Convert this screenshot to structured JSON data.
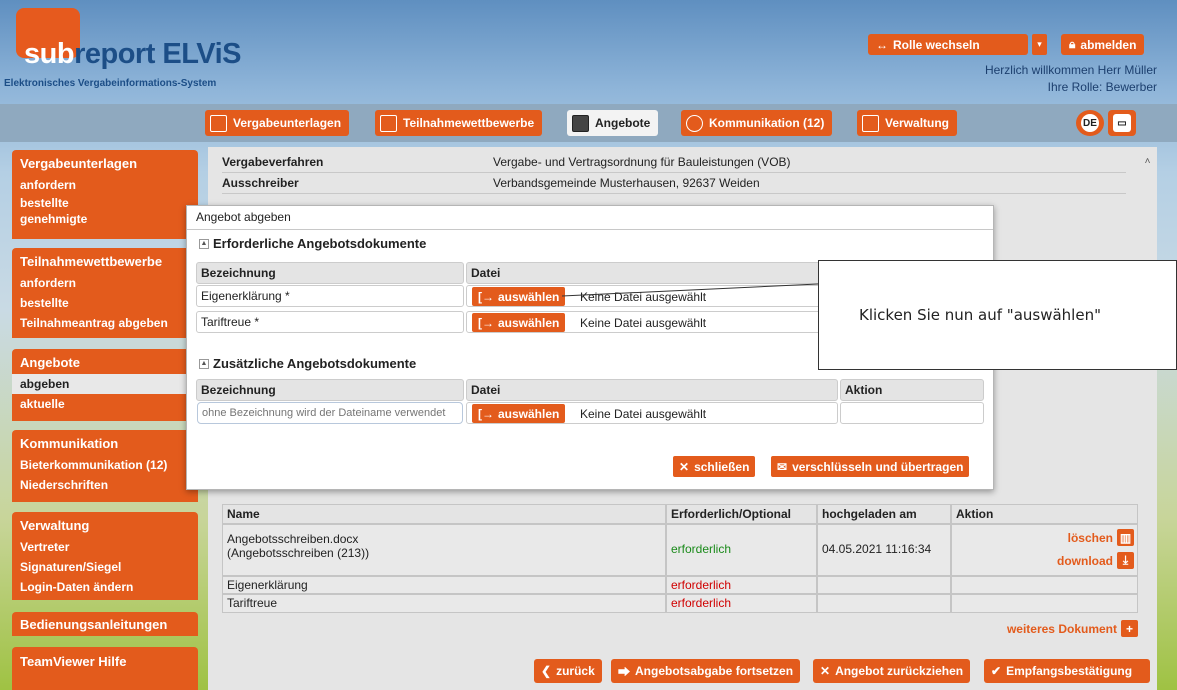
{
  "logo": {
    "sub": "sub",
    "report": "report ELViS",
    "subtitle": "Elektronisches Vergabeinformations-System"
  },
  "header": {
    "role_switch": "Rolle wechseln",
    "logout": "abmelden",
    "welcome": "Herzlich willkommen Herr Müller",
    "role": "Ihre Rolle: Bewerber"
  },
  "nav": [
    {
      "label": "Vergabeunterlagen"
    },
    {
      "label": "Teilnahmewettbewerbe"
    },
    {
      "label": "Angebote"
    },
    {
      "label": "Kommunikation (12)"
    },
    {
      "label": "Verwaltung"
    }
  ],
  "lang": "DE",
  "sidebar": {
    "g1": {
      "title": "Vergabeunterlagen",
      "items": [
        "anfordern",
        "bestellte",
        "genehmigte"
      ]
    },
    "g2": {
      "title": "Teilnahmewettbewerbe",
      "items": [
        "anfordern",
        "bestellte",
        "Teilnahmeantrag abgeben"
      ]
    },
    "g3": {
      "title": "Angebote",
      "items": [
        "abgeben",
        "aktuelle"
      ]
    },
    "g4": {
      "title": "Kommunikation",
      "items": [
        "Bieterkommunikation (12)",
        "Niederschriften"
      ]
    },
    "g5": {
      "title": "Verwaltung",
      "items": [
        "Vertreter",
        "Signaturen/Siegel",
        "Login-Daten ändern"
      ]
    },
    "g6": {
      "title": "Bedienungsanleitungen"
    },
    "g7": {
      "title": "TeamViewer Hilfe"
    }
  },
  "details": [
    {
      "k": "Vergabeverfahren",
      "v": "Vergabe- und Vertragsordnung für Bauleistungen (VOB)"
    },
    {
      "k": "Ausschreiber",
      "v": "Verbandsgemeinde Musterhausen, 92637 Weiden"
    }
  ],
  "modal": {
    "title": "Angebot abgeben",
    "sect1": "Erforderliche Angebotsdokumente",
    "sect2": "Zusätzliche Angebotsdokumente",
    "col_name": "Bezeichnung",
    "col_file": "Datei",
    "col_action": "Aktion",
    "rows": [
      {
        "name": "Eigenerklärung *"
      },
      {
        "name": "Tariftreue *"
      }
    ],
    "choose": "auswählen",
    "no_file": "Keine Datei ausgewählt",
    "placeholder": "ohne Bezeichnung wird der Dateiname verwendet",
    "close": "schließen",
    "encrypt": "verschlüsseln und übertragen"
  },
  "callout": "Klicken Sie nun auf \"auswählen\"",
  "doc_table": {
    "headers": [
      "Name",
      "Erforderlich/Optional",
      "hochgeladen am",
      "Aktion"
    ],
    "rows": [
      {
        "name1": "Angebotsschreiben.docx",
        "name2": "(Angebotsschreiben (213))",
        "req": "erforderlich",
        "date": "04.05.2021 11:16:34"
      },
      {
        "name1": "Eigenerklärung",
        "req": "erforderlich"
      },
      {
        "name1": "Tariftreue",
        "req": "erforderlich"
      }
    ],
    "delete": "löschen",
    "download": "download",
    "more": "weiteres Dokument"
  },
  "bottom": {
    "back": "zurück",
    "continue": "Angebotsabgabe fortsetzen",
    "withdraw": "Angebot zurückziehen",
    "receipt": "Empfangsbestätigung"
  }
}
